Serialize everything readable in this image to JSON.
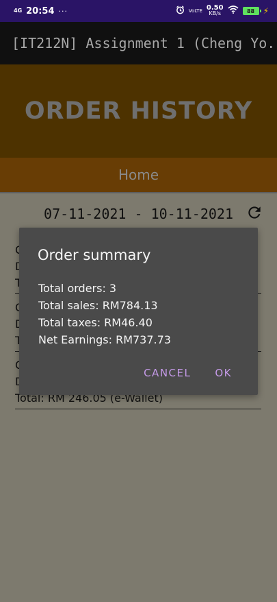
{
  "status_bar": {
    "network": "4G",
    "time": "20:54",
    "dots": "···",
    "volte": "VoLTE",
    "speed_value": "0.50",
    "speed_unit": "KB/s",
    "battery": "88"
  },
  "app_bar": {
    "title": "[IT212N] Assignment 1 (Cheng Yo..."
  },
  "header": {
    "title": "ORDER HISTORY"
  },
  "nav": {
    "home_label": "Home"
  },
  "date_range": {
    "text": "07-11-2021 - 10-11-2021"
  },
  "orders": [
    {
      "line1": "O",
      "line2": "D",
      "line3": "T"
    },
    {
      "line1": "O",
      "line2": "D",
      "line3": "T"
    },
    {
      "line1": "O",
      "line2": "D",
      "line3": "Total:  RM 246.05 (e-Wallet)"
    }
  ],
  "dialog": {
    "title": "Order summary",
    "total_orders": "Total orders: 3",
    "total_sales": "Total sales: RM784.13",
    "total_taxes": "Total taxes: RM46.40",
    "net_earnings": "Net Earnings: RM737.73",
    "cancel_label": "CANCEL",
    "ok_label": "OK"
  },
  "colors": {
    "status_bar": "#2a1466",
    "app_bar": "#101010",
    "header": "#4d3200",
    "nav": "#683d05",
    "dialog": "#4a4a4a",
    "dialog_button": "#c59ae8",
    "scrim_bg": "#7d7a6e"
  },
  "icons": {
    "refresh": "refresh-icon"
  }
}
